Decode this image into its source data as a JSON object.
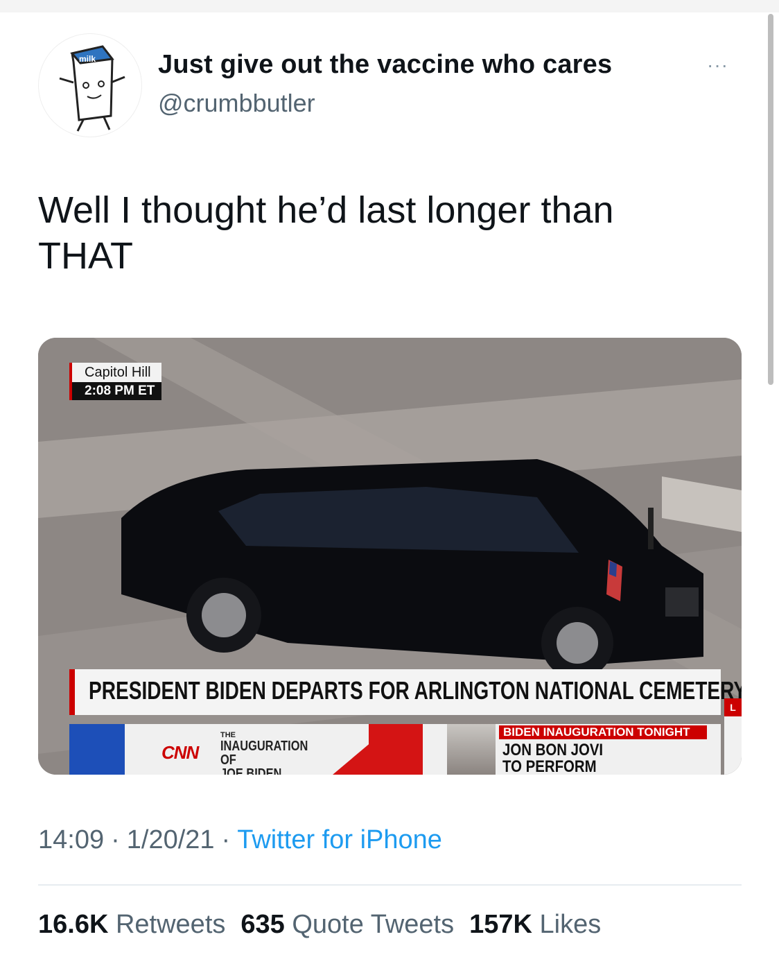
{
  "user": {
    "display_name": "Just give out the vaccine who cares",
    "handle": "@crumbbutler",
    "avatar_icon": "milk-carton-avatar-icon"
  },
  "more_label": "···",
  "tweet": {
    "text": "Well I thought he’d last longer than\nTHAT"
  },
  "media": {
    "location": "Capitol Hill",
    "time": "2:08 PM ET",
    "headline": "PRESIDENT BIDEN DEPARTS FOR ARLINGTON NATIONAL CEMETERY",
    "ticker": {
      "network": "CNN",
      "program_the": "THE",
      "program_title": "INAUGURATION OF\nJOE BIDEN",
      "promo_header": "BIDEN INAUGURATION TONIGHT",
      "promo_text": "JON BON JOVI\nTO PERFORM",
      "edge_letter": "L"
    }
  },
  "meta": {
    "time": "14:09",
    "date": "1/20/21",
    "source": "Twitter for iPhone"
  },
  "stats": {
    "retweets_count": "16.6K",
    "retweets_label": "Retweets",
    "quotes_count": "635",
    "quotes_label": "Quote Tweets",
    "likes_count": "157K",
    "likes_label": "Likes"
  },
  "colors": {
    "link": "#1d9bf0",
    "secondary_text": "#536471",
    "cnn_red": "#cc0000"
  }
}
